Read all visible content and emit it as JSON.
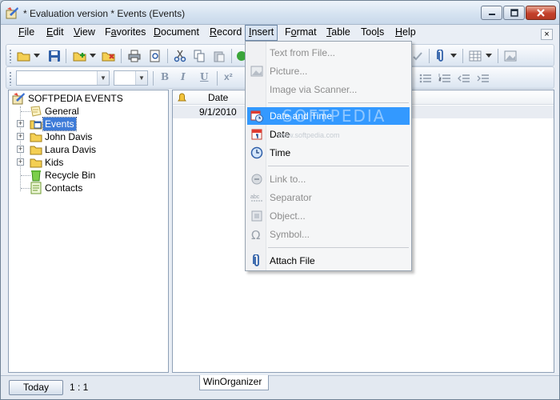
{
  "window": {
    "title": "* Evaluation version * Events (Events)"
  },
  "menubar": {
    "items": [
      {
        "label": "File",
        "underline": "F"
      },
      {
        "label": "Edit",
        "underline": "E"
      },
      {
        "label": "View",
        "underline": "V"
      },
      {
        "label": "Favorites",
        "underline": "a"
      },
      {
        "label": "Document",
        "underline": "D"
      },
      {
        "label": "Record",
        "underline": "R"
      },
      {
        "label": "Insert",
        "underline": "I",
        "active": true
      },
      {
        "label": "Format",
        "underline": "o"
      },
      {
        "label": "Table",
        "underline": "T"
      },
      {
        "label": "Tools",
        "underline": "l"
      },
      {
        "label": "Help",
        "underline": "H"
      }
    ],
    "mdi_close": "×"
  },
  "format_toolbar": {
    "bold": "B",
    "italic": "I",
    "underline": "U",
    "superscript": "x²"
  },
  "tree": {
    "root": "SOFTPEDIA EVENTS",
    "items": [
      {
        "label": "General",
        "expandable": false,
        "icon": "note-icon"
      },
      {
        "label": "Events",
        "expandable": true,
        "selected": true,
        "icon": "calendar-folder-icon"
      },
      {
        "label": "John Davis",
        "expandable": true,
        "icon": "folder-icon"
      },
      {
        "label": "Laura Davis",
        "expandable": true,
        "icon": "folder-icon"
      },
      {
        "label": "Kids",
        "expandable": true,
        "icon": "folder-icon"
      },
      {
        "label": "Recycle Bin",
        "expandable": false,
        "icon": "recycle-bin-icon"
      },
      {
        "label": "Contacts",
        "expandable": false,
        "icon": "contacts-icon"
      }
    ]
  },
  "grid": {
    "columns": [
      "Date"
    ],
    "rows": [
      {
        "date": "9/1/2010"
      }
    ]
  },
  "insert_menu": {
    "items": [
      {
        "label": "Text from File...",
        "enabled": false,
        "icon": ""
      },
      {
        "label": "Picture...",
        "enabled": false,
        "icon": "picture-icon"
      },
      {
        "label": "Image via Scanner...",
        "enabled": false,
        "icon": ""
      },
      {
        "label": "Date and Time",
        "enabled": true,
        "highlighted": true,
        "icon": "date-time-icon"
      },
      {
        "label": "Date",
        "enabled": true,
        "icon": "date-icon"
      },
      {
        "label": "Time",
        "enabled": true,
        "icon": "clock-icon"
      },
      {
        "label": "Link to...",
        "enabled": false,
        "icon": "link-icon"
      },
      {
        "label": "Separator",
        "enabled": false,
        "icon": "separator-icon"
      },
      {
        "label": "Object...",
        "enabled": false,
        "icon": "object-icon"
      },
      {
        "label": "Symbol...",
        "enabled": false,
        "icon": "omega-icon"
      },
      {
        "label": "Attach File",
        "enabled": true,
        "icon": "paperclip-icon"
      }
    ]
  },
  "watermark": {
    "brand": "SOFTPEDIA",
    "url": "www.softpedia.com"
  },
  "statusbar": {
    "today_label": "Today",
    "counter": "1 : 1",
    "tab_label": "WinOrganizer"
  },
  "colors": {
    "highlight": "#3399ff",
    "selection": "#3d7bd8",
    "folder": "#f5d34f",
    "close_button": "#c4402a"
  }
}
